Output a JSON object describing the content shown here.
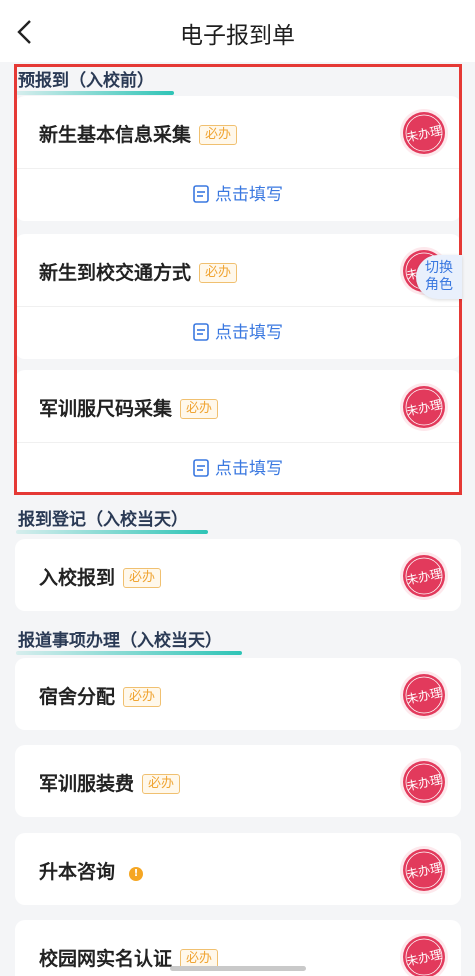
{
  "nav": {
    "title": "电子报到单"
  },
  "sections": [
    {
      "title": "预报到（入校前）"
    },
    {
      "title": "报到登记（入校当天）"
    },
    {
      "title": "报道事项办理（入校当天）"
    }
  ],
  "pre_items": [
    {
      "name": "新生基本信息采集",
      "tag": "必办",
      "status": "未办理",
      "action": "点击填写"
    },
    {
      "name": "新生到校交通方式",
      "tag": "必办",
      "status": "未办理",
      "action": "点击填写"
    },
    {
      "name": "军训服尺码采集",
      "tag": "必办",
      "status": "未办理",
      "action": "点击填写"
    }
  ],
  "register_items": [
    {
      "name": "入校报到",
      "tag": "必办",
      "status": "未办理"
    }
  ],
  "affairs_items": [
    {
      "name": "宿舍分配",
      "tag": "必办",
      "status": "未办理"
    },
    {
      "name": "军训服装费",
      "tag": "必办",
      "status": "未办理"
    },
    {
      "name": "升本咨询",
      "info_icon": "info-icon",
      "status": "未办理"
    },
    {
      "name": "校园网实名认证",
      "tag": "必办",
      "status": "未办理"
    }
  ],
  "switch_role": {
    "line1": "切换",
    "line2": "角色"
  },
  "colors": {
    "accent": "#3a78e0",
    "stamp": "#e23a5c",
    "tag": "#f0a534",
    "highlight": "#e53935"
  }
}
